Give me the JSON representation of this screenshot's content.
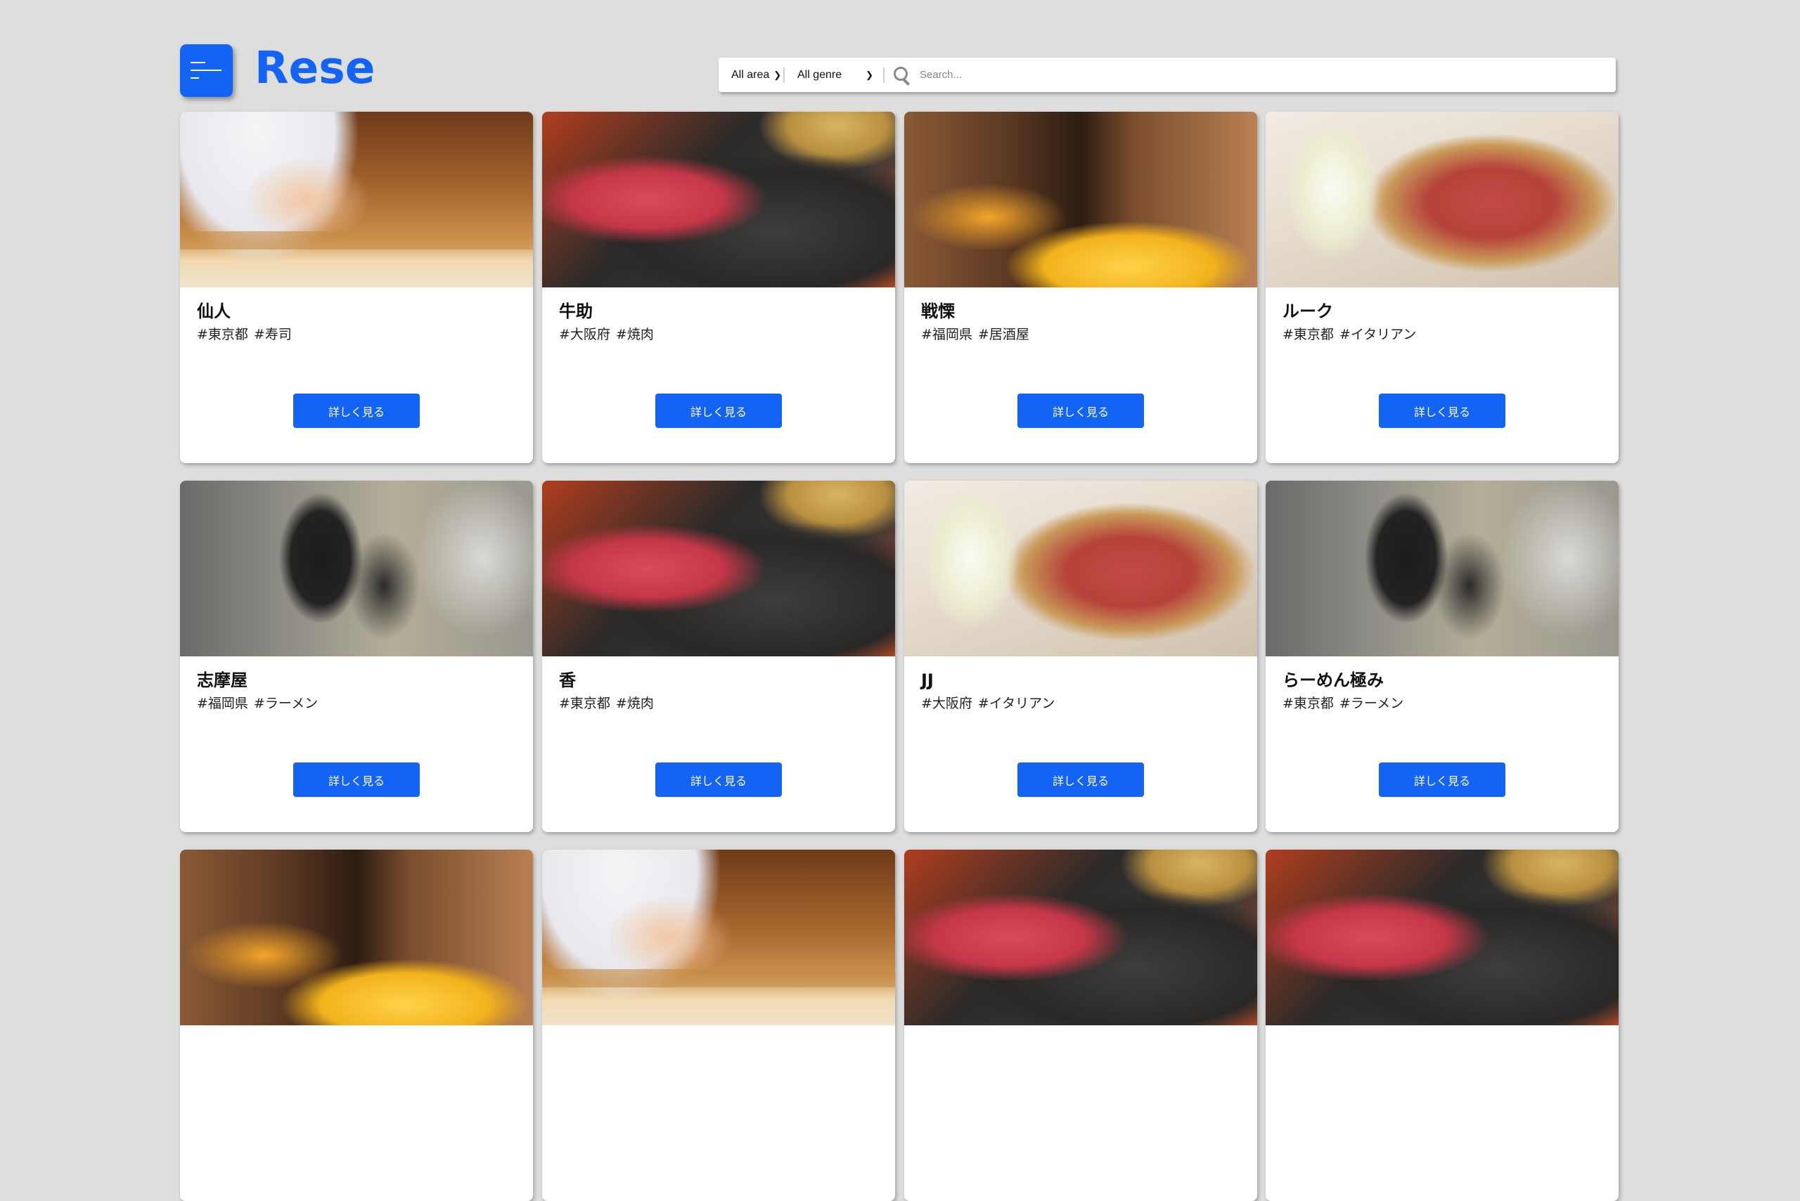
{
  "header": {
    "logo": "Rese",
    "menu_icon": "menu-icon"
  },
  "search": {
    "area_value": "All area",
    "genre_value": "All genre",
    "placeholder": "Search...",
    "icon": "search-icon"
  },
  "shops": [
    {
      "name": "仙人",
      "area": "#東京都",
      "genre": "#寿司",
      "image": "sushi-chef-photo",
      "button": "詳しく見る"
    },
    {
      "name": "牛助",
      "area": "#大阪府",
      "genre": "#焼肉",
      "image": "yakiniku-beef-photo",
      "button": "詳しく見る"
    },
    {
      "name": "戦慄",
      "area": "#福岡県",
      "genre": "#居酒屋",
      "image": "izakaya-interior-photo",
      "button": "詳しく見る"
    },
    {
      "name": "ルーク",
      "area": "#東京都",
      "genre": "#イタリアン",
      "image": "pizza-wine-photo",
      "button": "詳しく見る"
    },
    {
      "name": "志摩屋",
      "area": "#福岡県",
      "genre": "#ラーメン",
      "image": "ramen-kitchen-photo",
      "button": "詳しく見る"
    },
    {
      "name": "香",
      "area": "#東京都",
      "genre": "#焼肉",
      "image": "yakiniku-beef-photo",
      "button": "詳しく見る"
    },
    {
      "name": "JJ",
      "area": "#大阪府",
      "genre": "#イタリアン",
      "image": "pizza-wine-photo",
      "button": "詳しく見る"
    },
    {
      "name": "らーめん極み",
      "area": "#東京都",
      "genre": "#ラーメン",
      "image": "ramen-kitchen-photo",
      "button": "詳しく見る"
    },
    {
      "image": "izakaya-interior-photo"
    },
    {
      "image": "sushi-chef-photo"
    },
    {
      "image": "yakiniku-beef-photo"
    },
    {
      "image": "yakiniku-beef-photo"
    }
  ],
  "colors": {
    "brand": "#1363f5",
    "background": "#dedede"
  }
}
